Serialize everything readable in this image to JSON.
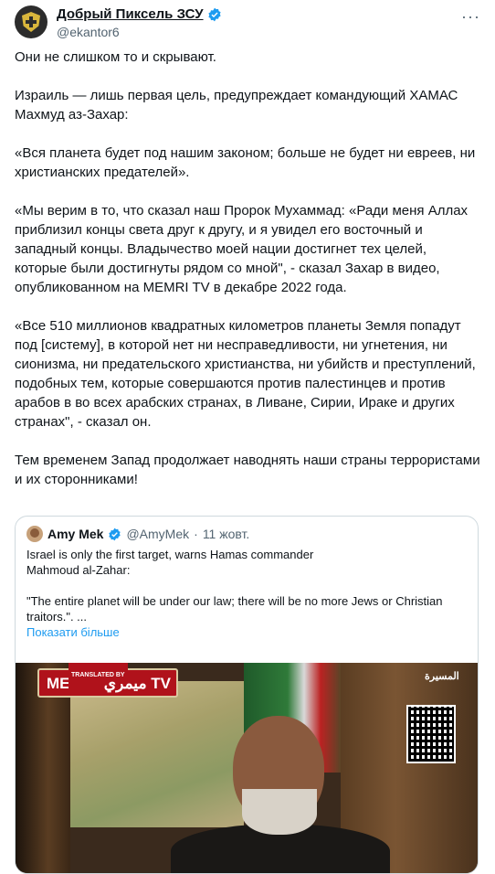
{
  "author": {
    "display_name": "Добрый Пиксель ЗСУ",
    "handle": "@ekantor6",
    "verified_color": "#1d9bf0"
  },
  "post": {
    "paragraphs": [
      "Они не слишком то и скрывают.",
      "Израиль — лишь первая цель, предупреждает командующий ХАМАС Махмуд аз-Захар:",
      "«Вся планета будет под нашим законом; больше не будет ни евреев, ни христианских предателей».",
      "«Мы верим в то, что сказал наш Пророк Мухаммад: «Ради меня Аллах приблизил концы света друг к другу, и я увидел его восточный и западный концы. Владычество моей нации достигнет тех целей, которые были достигнуты рядом со мной\", - сказал Захар в видео, опубликованном на MEMRI TV в декабре 2022 года.",
      "«Все 510 миллионов квадратных километров планеты Земля попадут под [систему], в которой нет ни несправедливости, ни угнетения, ни сионизма, ни предательского христианства, ни убийств и преступлений, подобных тем, которые совершаются против палестинцев и против арабов в во всех арабских странах, в Ливане, Сирии, Ираке и других странах\", - сказал он.",
      "Тем временем Запад продолжает наводнять наши страны террористами и их сторонниками!"
    ]
  },
  "quoted": {
    "name": "Amy Mek",
    "handle": "@AmyMek",
    "separator": "·",
    "date": "11 жовт.",
    "line1": "Israel is only the first target, warns Hamas commander",
    "line2": "Mahmoud al-Zahar:",
    "line3": "\"The entire planet will be under our law; there will be no more Jews or Christian",
    "line4": "traitors.\". ...",
    "show_more": "Показати більше",
    "video": {
      "logo_text": "MEMRI",
      "logo_small": "TRANSLATED BY",
      "logo_tv": "ميمري TV",
      "channel": "المسيرة"
    }
  }
}
